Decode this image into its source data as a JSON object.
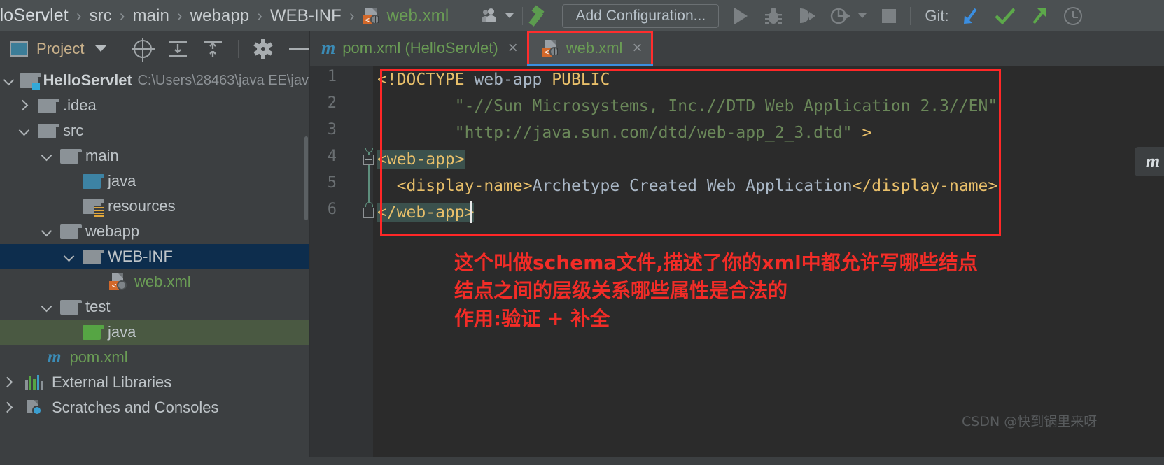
{
  "topbar": {
    "breadcrumbs": [
      {
        "label": "lloServlet",
        "type": "project"
      },
      {
        "label": "src",
        "type": "dir"
      },
      {
        "label": "main",
        "type": "dir"
      },
      {
        "label": "webapp",
        "type": "dir"
      },
      {
        "label": "WEB-INF",
        "type": "dir"
      },
      {
        "label": "web.xml",
        "type": "file",
        "icon": "xml-file-icon"
      }
    ],
    "separator": "›",
    "user_icon": "users-icon",
    "build_icon": "hammer-build-icon",
    "run_config": {
      "label": "Add Configuration...",
      "placeholder": "Add Configuration..."
    },
    "run_icon": "run-triangle-icon",
    "debug_icon": "debug-bug-icon",
    "run_coverage_icon": "run-with-coverage-icon",
    "profiler_icon": "profiler-icon",
    "dropdown_icon": "chevron-down-icon",
    "stop_icon": "stop-square-icon",
    "git_label": "Git:",
    "git_update_icon": "update-project-arrow-icon",
    "git_commit_icon": "commit-check-icon",
    "git_push_icon": "push-arrow-icon",
    "history_icon": "history-clock-icon",
    "colors": {
      "bar_bg": "#4b5052",
      "accent_green": "#5c9c4f",
      "accent_blue": "#3b8ee0",
      "file_green": "#6a9c55"
    }
  },
  "project_panel": {
    "title": "Project",
    "window_icon": "project-window-icon",
    "title_caret": "chevron-down-icon",
    "actions": [
      {
        "name": "select-opened-file-icon",
        "label": "Select Opened File"
      },
      {
        "name": "expand-all-icon",
        "label": "Expand All"
      },
      {
        "name": "collapse-all-icon",
        "label": "Collapse All"
      },
      {
        "name": "gear-settings-icon",
        "label": "Settings"
      },
      {
        "name": "hide-panel-icon",
        "label": "Hide"
      }
    ]
  },
  "tree": {
    "items": [
      {
        "label": "HelloServlet",
        "path": "C:\\Users\\28463\\java EE\\jav",
        "icon": "module-folder-icon",
        "chevron": "down",
        "indent": 0,
        "bold": true,
        "selected": "none"
      },
      {
        "label": ".idea",
        "icon": "folder-icon",
        "chevron": "right",
        "indent": 1,
        "selected": "none"
      },
      {
        "label": "src",
        "icon": "folder-icon",
        "chevron": "down",
        "indent": 1,
        "selected": "none"
      },
      {
        "label": "main",
        "icon": "folder-icon",
        "chevron": "down",
        "indent": 2,
        "selected": "none"
      },
      {
        "label": "java",
        "icon": "source-folder-icon",
        "chevron": "none",
        "indent": 3,
        "selected": "none"
      },
      {
        "label": "resources",
        "icon": "resources-folder-icon",
        "chevron": "none",
        "indent": 3,
        "selected": "none"
      },
      {
        "label": "webapp",
        "icon": "folder-icon",
        "chevron": "down",
        "indent": 3,
        "selected": "none"
      },
      {
        "label": "WEB-INF",
        "icon": "folder-icon",
        "chevron": "down",
        "indent": 4,
        "selected": "blue"
      },
      {
        "label": "web.xml",
        "icon": "xml-file-icon",
        "chevron": "none",
        "indent": 5,
        "selected": "none",
        "green": true
      },
      {
        "label": "test",
        "icon": "folder-icon",
        "chevron": "down",
        "indent": 2,
        "selected": "none"
      },
      {
        "label": "java",
        "icon": "test-source-folder-icon",
        "chevron": "none",
        "indent": 3,
        "selected": "green"
      },
      {
        "label": "pom.xml",
        "icon": "maven-icon",
        "chevron": "none",
        "indent": 2,
        "selected": "none",
        "green": true
      },
      {
        "label": "External Libraries",
        "icon": "external-libraries-icon",
        "chevron": "right",
        "indent": 0,
        "selected": "none"
      },
      {
        "label": "Scratches and Consoles",
        "icon": "scratches-icon",
        "chevron": "none",
        "indent": 0,
        "selected": "none"
      }
    ]
  },
  "tabs": [
    {
      "label": "pom.xml (HelloServlet)",
      "icon": "maven-icon",
      "close": "×",
      "active": false
    },
    {
      "label": "web.xml",
      "icon": "xml-file-icon",
      "close": "×",
      "active": true
    }
  ],
  "editor": {
    "line_numbers": [
      "1",
      "2",
      "3",
      "4",
      "5",
      "6"
    ],
    "lines": [
      {
        "n": 1,
        "tokens": [
          {
            "t": "<!DOCTYPE",
            "c": "tk-dtd"
          },
          {
            "t": " web-app ",
            "c": "tk-name"
          },
          {
            "t": "PUBLIC",
            "c": "tk-kw"
          }
        ]
      },
      {
        "n": 2,
        "tokens": [
          {
            "t": "        \"-//Sun Microsystems, Inc.//DTD Web Application 2.3//EN\"",
            "c": "tk-str"
          }
        ]
      },
      {
        "n": 3,
        "tokens": [
          {
            "t": "        \"http://java.sun.com/dtd/web-app_2_3.dtd\"",
            "c": "tk-str"
          },
          {
            "t": " >",
            "c": "tk-dtd"
          }
        ]
      },
      {
        "n": 4,
        "tokens": [
          {
            "t": "<web-app>",
            "c": "tk-tag hl-match"
          }
        ]
      },
      {
        "n": 5,
        "tokens": [
          {
            "t": "  ",
            "c": "tk-txt"
          },
          {
            "t": "<display-name>",
            "c": "tk-tag"
          },
          {
            "t": "Archetype Created Web Application",
            "c": "tk-txt"
          },
          {
            "t": "</display-name>",
            "c": "tk-tag"
          }
        ]
      },
      {
        "n": 6,
        "tokens": [
          {
            "t": "</web-app>",
            "c": "tk-tag hl-match"
          }
        ]
      }
    ],
    "fold_markers": [
      "line-4-fold-open",
      "line-6-fold-close"
    ],
    "caret_line": 6,
    "hint_badge": "m"
  },
  "annotations": {
    "box_color": "#ff2727",
    "tab_box_color": "#ff2d2d",
    "note_color": "#f22c27",
    "note_lines": [
      "这个叫做schema文件,描述了你的xml中都允许写哪些结点",
      "结点之间的层级关系哪些属性是合法的",
      "作用:验证 + 补全"
    ]
  },
  "watermark": "CSDN @快到锅里来呀"
}
